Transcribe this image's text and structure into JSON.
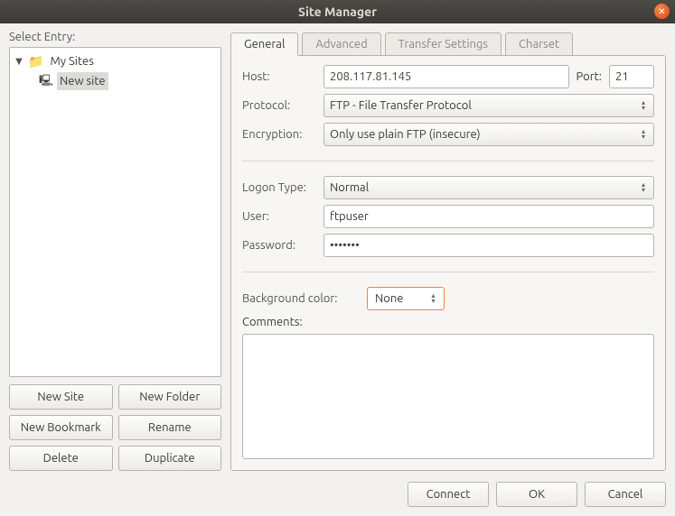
{
  "window": {
    "title": "Site Manager"
  },
  "sidebar": {
    "label": "Select Entry:",
    "root": {
      "label": "My Sites"
    },
    "entry": {
      "label": "New site"
    }
  },
  "entry_buttons": {
    "new_site": "New Site",
    "new_folder": "New Folder",
    "new_bookmark": "New Bookmark",
    "rename": "Rename",
    "delete": "Delete",
    "duplicate": "Duplicate"
  },
  "tabs": {
    "general": "General",
    "advanced": "Advanced",
    "transfer": "Transfer Settings",
    "charset": "Charset"
  },
  "fields": {
    "host_label": "Host:",
    "host_value": "208.117.81.145",
    "port_label": "Port:",
    "port_value": "21",
    "protocol_label": "Protocol:",
    "protocol_value": "FTP - File Transfer Protocol",
    "encryption_label": "Encryption:",
    "encryption_value": "Only use plain FTP (insecure)",
    "logon_type_label": "Logon Type:",
    "logon_type_value": "Normal",
    "user_label": "User:",
    "user_value": "ftpuser",
    "password_label": "Password:",
    "password_value": "•••••••",
    "bgcolor_label": "Background color:",
    "bgcolor_value": "None",
    "comments_label": "Comments:",
    "comments_value": ""
  },
  "footer": {
    "connect": "Connect",
    "ok": "OK",
    "cancel": "Cancel"
  }
}
